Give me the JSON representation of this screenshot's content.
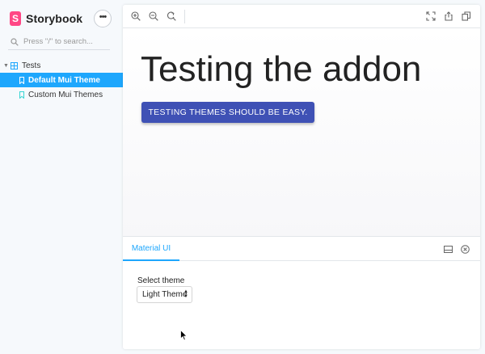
{
  "app": {
    "brand": "Storybook",
    "logo_letter": "S"
  },
  "search": {
    "placeholder": "Press \"/\" to search..."
  },
  "sidebar": {
    "group": "Tests",
    "items": [
      {
        "label": "Default Mui Theme",
        "selected": true
      },
      {
        "label": "Custom Mui Themes",
        "selected": false
      }
    ]
  },
  "toolbar": {
    "left_icons": [
      "zoom-in-icon",
      "zoom-out-icon",
      "reset-zoom-icon"
    ],
    "right_icons": [
      "fullscreen-icon",
      "share-icon",
      "copy-icon"
    ]
  },
  "preview": {
    "heading": "Testing the addon",
    "button_label": "TESTING THEMES SHOULD BE EASY."
  },
  "addons": {
    "tab_label": "Material UI",
    "select_label": "Select theme",
    "select_value": "Light Theme"
  },
  "colors": {
    "accent": "#1ea7fd",
    "brand": "#ff4785",
    "button": "#3f51b5"
  }
}
